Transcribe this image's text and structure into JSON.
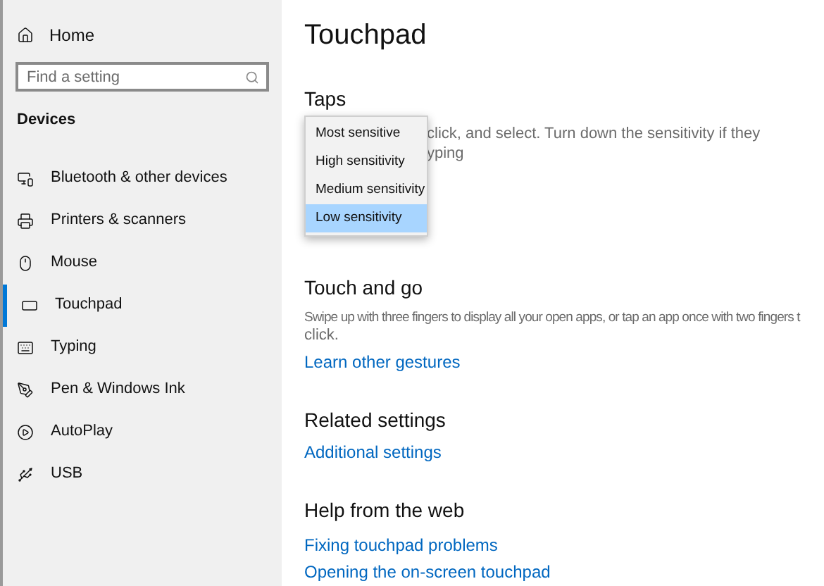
{
  "sidebar": {
    "home": "Home",
    "search": {
      "placeholder": "Find a setting"
    },
    "section": "Devices",
    "items": [
      {
        "label": "Bluetooth & other devices",
        "selected": false
      },
      {
        "label": "Printers & scanners",
        "selected": false
      },
      {
        "label": "Mouse",
        "selected": false
      },
      {
        "label": "Touchpad",
        "selected": true
      },
      {
        "label": "Typing",
        "selected": false
      },
      {
        "label": "Pen & Windows Ink",
        "selected": false
      },
      {
        "label": "AutoPlay",
        "selected": false
      },
      {
        "label": "USB",
        "selected": false
      }
    ]
  },
  "main": {
    "title": "Touchpad",
    "taps": {
      "heading": "Taps",
      "description_lines": [
        "click, and select. Turn down the sensitivity if they",
        "yping"
      ],
      "dropdown_options": [
        {
          "label": "Most sensitive",
          "selected": false
        },
        {
          "label": "High sensitivity",
          "selected": false
        },
        {
          "label": "Medium sensitivity",
          "selected": false
        },
        {
          "label": "Low sensitivity",
          "selected": true
        }
      ]
    },
    "touch_and_go": {
      "heading": "Touch and go",
      "description": "Swipe up with three fingers to display all your open apps, or tap an app once with two fingers t",
      "description_line_2": "click.",
      "link": "Learn other gestures"
    },
    "related": {
      "heading": "Related settings",
      "links": [
        "Additional settings"
      ]
    },
    "help": {
      "heading": "Help from the web",
      "links": [
        "Fixing touchpad problems",
        "Opening the on-screen touchpad"
      ]
    }
  }
}
